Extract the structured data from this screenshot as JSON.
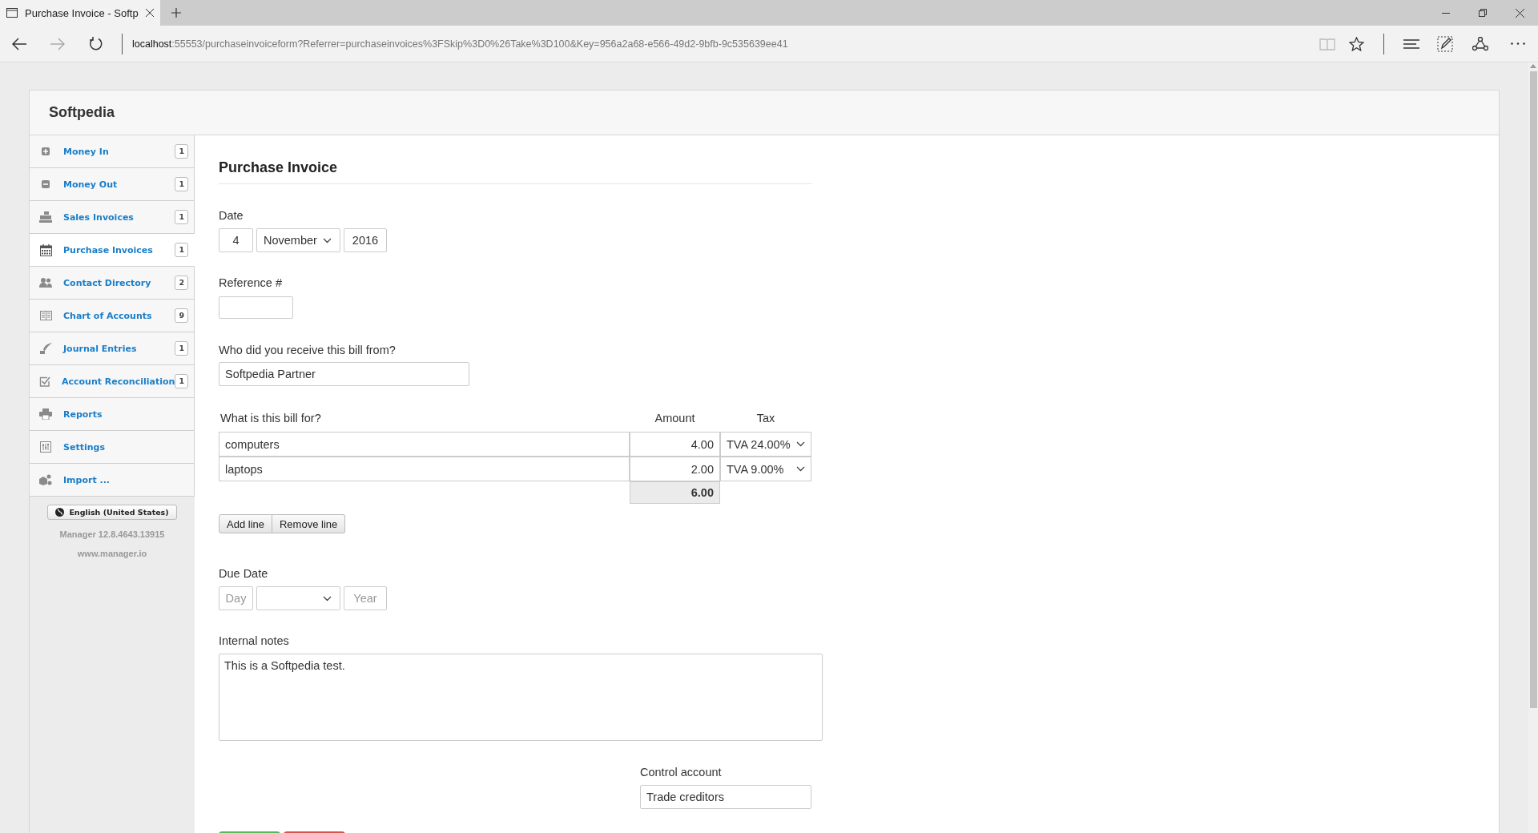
{
  "browser": {
    "tab_title": "Purchase Invoice - Softp",
    "url_host": "localhost",
    "url_rest": ":55553/purchaseinvoiceform?Referrer=purchaseinvoices%3FSkip%3D0%26Take%3D100&Key=956a2a68-e566-49d2-9bfb-9c535639ee41",
    "forward_disabled": true,
    "reading_view_disabled": true
  },
  "app": {
    "brand": "Softpedia",
    "sidebar": [
      {
        "kind": "plus",
        "label": "Money In",
        "count": "1",
        "selected": false
      },
      {
        "kind": "minus",
        "label": "Money Out",
        "count": "1",
        "selected": false
      },
      {
        "kind": "register",
        "label": "Sales Invoices",
        "count": "1",
        "selected": false
      },
      {
        "kind": "calendar",
        "label": "Purchase Invoices",
        "count": "1",
        "selected": true
      },
      {
        "kind": "people",
        "label": "Contact Directory",
        "count": "2",
        "selected": false
      },
      {
        "kind": "book",
        "label": "Chart of Accounts",
        "count": "9",
        "selected": false
      },
      {
        "kind": "quill",
        "label": "Journal Entries",
        "count": "1",
        "selected": false
      },
      {
        "kind": "check",
        "label": "Account Reconciliation",
        "count": "1",
        "selected": false
      },
      {
        "kind": "printer",
        "label": "Reports",
        "selected": false
      },
      {
        "kind": "sliders",
        "label": "Settings",
        "selected": false
      },
      {
        "kind": "cubes",
        "label": "Import ...",
        "selected": false
      }
    ],
    "language": "English (United States)",
    "version": "Manager 12.8.4643.13915",
    "website": "www.manager.io"
  },
  "form": {
    "title": "Purchase Invoice",
    "date": {
      "label": "Date",
      "day": "4",
      "month": "November",
      "year": "2016"
    },
    "reference": {
      "label": "Reference #"
    },
    "supplier": {
      "label": "Who did you receive this bill from?",
      "value": "Softpedia Partner"
    },
    "lines_header": {
      "description": "What is this bill for?",
      "amount": "Amount",
      "tax": "Tax"
    },
    "lines": [
      {
        "description": "computers",
        "amount": "4.00",
        "tax": "TVA 24.00%"
      },
      {
        "description": "laptops",
        "amount": "2.00",
        "tax": "TVA 9.00%"
      }
    ],
    "total": "6.00",
    "line_buttons": [
      "Add line",
      "Remove line"
    ],
    "due_date": {
      "label": "Due Date",
      "day_placeholder": "Day",
      "year_placeholder": "Year"
    },
    "notes": {
      "label": "Internal notes",
      "value": "This is a Softpedia test."
    },
    "control_account": {
      "label": "Control account",
      "value": "Trade creditors"
    },
    "actions": [
      {
        "kind": "save"
      },
      {
        "kind": "cancel"
      }
    ]
  }
}
